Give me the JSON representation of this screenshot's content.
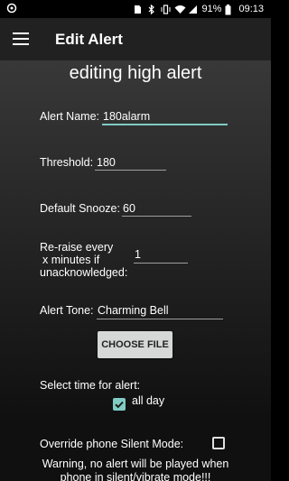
{
  "status_bar": {
    "battery": "91%",
    "time": "09:13",
    "left_icon": "circle-notification-icon",
    "icons": [
      "sim-icon",
      "bluetooth-icon",
      "vibrate-icon",
      "wifi-icon",
      "signal-icon",
      "battery-icon"
    ]
  },
  "toolbar": {
    "title": "Edit Alert",
    "menu_icon": "hamburger-menu-icon"
  },
  "form": {
    "heading": "editing high alert",
    "alert_name_label": "Alert Name:",
    "alert_name_value": "180alarm",
    "threshold_label": "Threshold:",
    "threshold_value": "180",
    "default_snooze_label": "Default Snooze:",
    "default_snooze_value": "60",
    "reraise_label_1": "Re-raise every",
    "reraise_label_2": "x minutes if",
    "reraise_label_3": "unacknowledged:",
    "reraise_value": "1",
    "alert_tone_label": "Alert Tone:",
    "alert_tone_value": "Charming Bell",
    "choose_file_button": "CHOOSE FILE",
    "select_time_label": "Select time for alert:",
    "all_day_label": "all day",
    "all_day_checked": true,
    "override_silent_label": "Override phone Silent Mode:",
    "override_silent_checked": false,
    "warning_text": "Warning, no alert will be played when phone in silent/vibrate mode!!!"
  },
  "colors": {
    "accent": "#80cbc4",
    "toolbar_bg": "#212121",
    "button_bg": "#d6d7d7"
  }
}
